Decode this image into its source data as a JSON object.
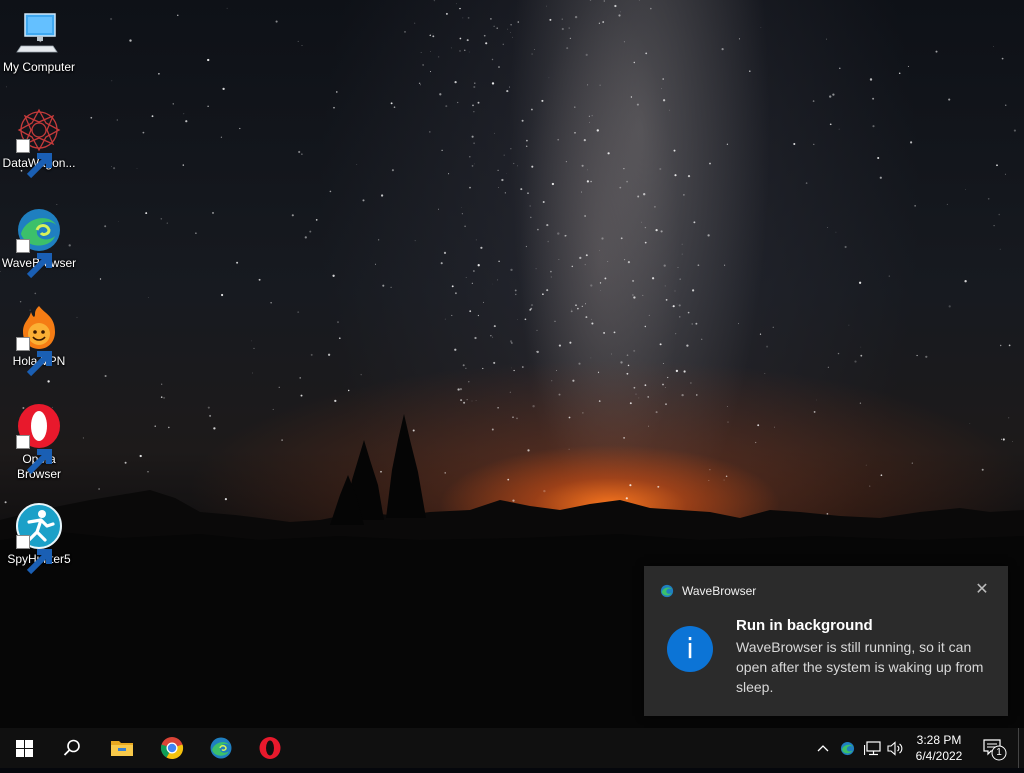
{
  "desktop": {
    "icons": [
      {
        "label": "My Computer",
        "icon": "computer-icon",
        "shortcut": false
      },
      {
        "label": "DataWagon...",
        "icon": "datawagon-icon",
        "shortcut": true
      },
      {
        "label": "WaveBrowser",
        "icon": "wavebrowser-icon",
        "shortcut": true
      },
      {
        "label": "Hola VPN",
        "icon": "hola-vpn-icon",
        "shortcut": true
      },
      {
        "label": "Opera Browser",
        "icon": "opera-icon",
        "shortcut": true
      },
      {
        "label": "SpyHunter5",
        "icon": "spyhunter-icon",
        "shortcut": true
      }
    ]
  },
  "toast": {
    "app_name": "WaveBrowser",
    "title": "Run in background",
    "body": "WaveBrowser is still running, so it can open after the system is waking up from sleep.",
    "info_glyph": "i",
    "close_glyph": "✕"
  },
  "taskbar": {
    "pinned": [
      "start-icon",
      "search-icon",
      "file-explorer-icon",
      "chrome-icon",
      "wavebrowser-icon",
      "opera-icon"
    ],
    "tray": {
      "chevron_glyph": "^",
      "time": "3:28 PM",
      "date": "6/4/2022",
      "notification_count": "1"
    }
  },
  "colors": {
    "toast_bg": "#2b2b2b",
    "info_blue": "#0c74d6",
    "taskbar_bg": "#101010"
  }
}
